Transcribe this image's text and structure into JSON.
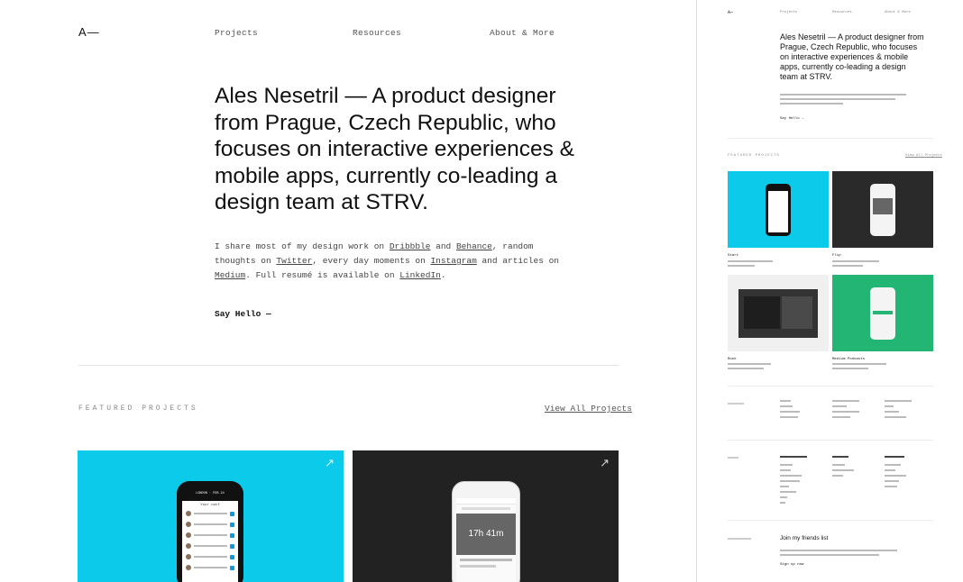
{
  "site": {
    "logo": "A—",
    "nav": [
      "Projects",
      "Resources",
      "About & More"
    ]
  },
  "hero": {
    "title": "Ales Nesetril — A product designer from Prague, Czech Republic, who focuses on interactive experiences & mobile apps, currently co-leading a design team at STRV."
  },
  "intro": {
    "t1": "I share most of my design work on ",
    "dribbble": "Dribbble",
    "t2": " and ",
    "behance": "Behance",
    "t3": ", random thoughts on ",
    "twitter": "Twitter",
    "t4": ", every day moments on ",
    "instagram": "Instagram",
    "t5": " and articles on ",
    "medium": "Medium",
    "t6": ". Full resumé is available on ",
    "linkedin": "LinkedIn",
    "t7": "."
  },
  "cta": {
    "say_hello": "Say Hello —"
  },
  "featured": {
    "label": "FEATURED PROJECTS",
    "view_all": "View All Projects",
    "cards": [
      {
        "bg": "#0ccbea",
        "phone_header": "LONDON · FEB 24",
        "phone_title": "Your outf"
      },
      {
        "bg": "#222222",
        "stat": "17h 41m"
      }
    ]
  },
  "preview": {
    "logo": "A—",
    "nav": [
      "Projects",
      "Resources",
      "About & More"
    ],
    "hero": "Ales Nesetril — A product designer from Prague, Czech Republic, who focuses on interactive experiences & mobile apps, currently co-leading a design team at STRV.",
    "say_hello": "Say Hello →",
    "featured_label": "FEATURED PROJECTS",
    "view_all": "View All Projects",
    "tiles": [
      {
        "name": "Start",
        "bg": "#0ccbea"
      },
      {
        "name": "Flip",
        "bg": "#2a2a2a"
      },
      {
        "name": "Rook",
        "bg": "#f0f0f0"
      },
      {
        "name": "Medium Podcasts",
        "bg": "#22b573"
      }
    ],
    "join_title": "Join my friends list",
    "signup": "Sign up now"
  },
  "colors": {
    "accent_cyan": "#0ccbea",
    "accent_green": "#22b573",
    "dark": "#222222"
  }
}
